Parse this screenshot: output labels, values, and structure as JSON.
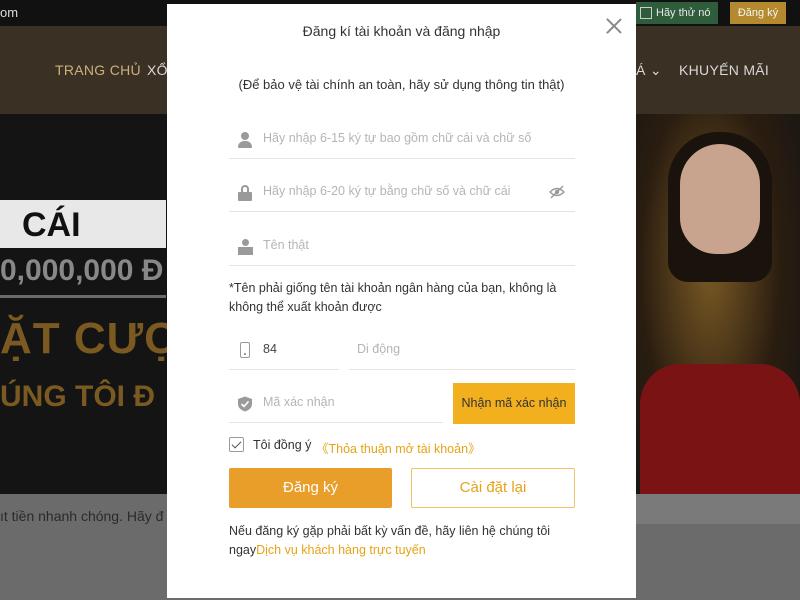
{
  "background": {
    "top_left_text": "om",
    "try_button": "Hãy thử nó",
    "register_top": "Đăng ký",
    "nav": [
      "TRANG CHỦ",
      "XỔ",
      "Á",
      "KHUYẾN MÃI"
    ],
    "hero_cai": "CÁI",
    "hero_amount": "0,000,000 Đ",
    "hero_bet": "ẶT CƯỢC",
    "hero_us": "ÚNG TÔI Đ",
    "bottom_text": "ıt tiền nhanh chóng. Hãy đ"
  },
  "modal": {
    "title": "Đăng kí tài khoản và đăng nhập",
    "subtitle": "(Để bảo vệ tài chính an toàn, hãy sử dụng thông tin thật)",
    "username_placeholder": "Hãy nhập 6-15 ký tự bao gồm chữ cái và chữ số",
    "password_placeholder": "Hãy nhập 6-20 ký tự bằng chữ số và chữ cái",
    "realname_placeholder": "Tên thật",
    "realname_note": "*Tên phải giống tên tài khoản ngân hàng của bạn, không là không thể xuất khoản được",
    "country_code": "84",
    "phone_placeholder": "Di động",
    "code_placeholder": "Mã xác nhận",
    "code_button": "Nhận mã xác nhận",
    "agree_text": "Tôi đồng ý",
    "agree_link": "《Thỏa thuận mở tài khoản》",
    "register_button": "Đăng ký",
    "reset_button": "Cài đặt lại",
    "help_text": "Nếu đăng ký gặp phải bất kỳ vấn đề, hãy liên hệ chúng tôi ngay",
    "help_link": "Dịch vụ khách hàng trực tuyến"
  },
  "colors": {
    "accent": "#e89e28",
    "code_button": "#f2b01e",
    "link": "#e6a317"
  }
}
